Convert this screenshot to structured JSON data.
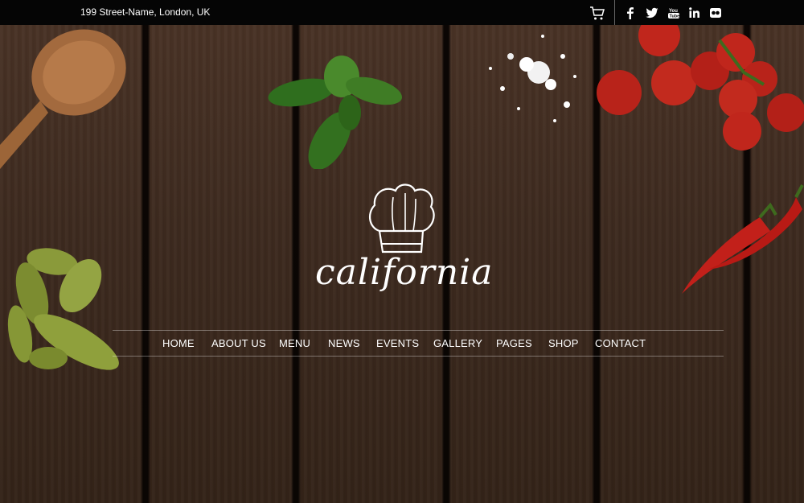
{
  "topbar": {
    "address": "199 Street-Name, London, UK",
    "icons": [
      "cart-icon",
      "facebook-icon",
      "twitter-icon",
      "youtube-icon",
      "linkedin-icon",
      "flickr-icon"
    ]
  },
  "brand": {
    "name": "california",
    "logo_icon": "chef-hat-icon"
  },
  "nav": {
    "items": [
      {
        "label": "HOME"
      },
      {
        "label": "ABOUT US"
      },
      {
        "label": "MENU"
      },
      {
        "label": "NEWS"
      },
      {
        "label": "EVENTS"
      },
      {
        "label": "GALLERY"
      },
      {
        "label": "PAGES"
      },
      {
        "label": "SHOP"
      },
      {
        "label": "CONTACT"
      }
    ]
  },
  "colors": {
    "topbar_bg": "#050505",
    "text": "#ffffff",
    "wood": "#3d2a1f"
  }
}
